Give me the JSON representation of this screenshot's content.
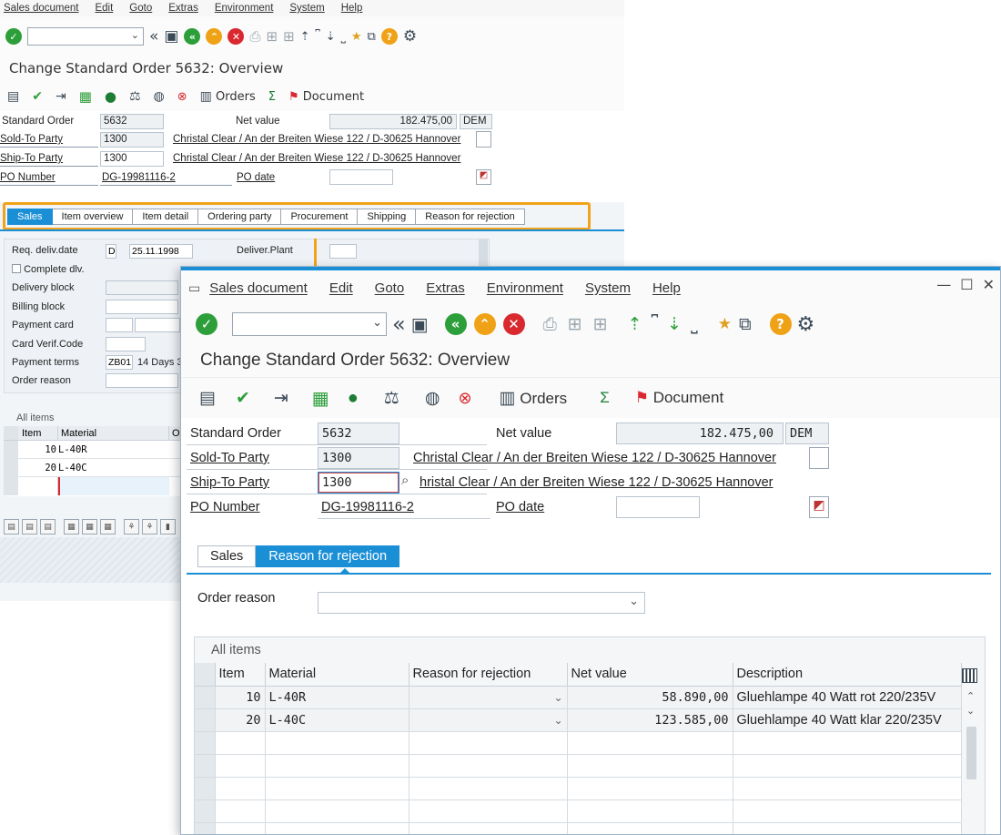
{
  "background_window": {
    "menu": [
      "Sales document",
      "Edit",
      "Goto",
      "Extras",
      "Environment",
      "System",
      "Help"
    ],
    "title": "Change Standard Order 5632: Overview",
    "app_toolbar": {
      "orders_label": "Orders",
      "sum_symbol": "Σ",
      "document_label": "Document"
    },
    "header": {
      "standard_order_label": "Standard Order",
      "standard_order_value": "5632",
      "net_value_label": "Net value",
      "net_value": "182.475,00",
      "currency": "DEM",
      "sold_to_label": "Sold-To Party",
      "sold_to_value": "1300",
      "sold_to_desc": "Christal Clear / An der Breiten Wiese 122 / D-30625 Hannover",
      "ship_to_label": "Ship-To Party",
      "ship_to_value": "1300",
      "ship_to_desc": "Christal Clear / An der Breiten Wiese 122 / D-30625 Hannover",
      "po_number_label": "PO Number",
      "po_number_value": "DG-19981116-2",
      "po_date_label": "PO date"
    },
    "tabs": [
      "Sales",
      "Item overview",
      "Item detail",
      "Ordering party",
      "Procurement",
      "Shipping",
      "Reason for rejection"
    ],
    "sales_panel": {
      "req_deliv_label": "Req. deliv.date",
      "req_deliv_format": "D",
      "req_deliv_value": "25.11.1998",
      "deliver_plant_label": "Deliver.Plant",
      "complete_dlv_label": "Complete dlv.",
      "delivery_block_label": "Delivery block",
      "billing_block_label": "Billing block",
      "payment_card_label": "Payment card",
      "card_verif_label": "Card Verif.Code",
      "payment_terms_label": "Payment terms",
      "payment_terms_value": "ZB01",
      "payment_terms_desc": "14 Days 3",
      "order_reason_label": "Order reason"
    },
    "items": {
      "title": "All items",
      "columns": [
        "Item",
        "Material",
        "O"
      ],
      "rows": [
        {
          "item": "10",
          "material": "L-40R"
        },
        {
          "item": "20",
          "material": "L-40C"
        }
      ]
    }
  },
  "foreground_window": {
    "menu": [
      "Sales document",
      "Edit",
      "Goto",
      "Extras",
      "Environment",
      "System",
      "Help"
    ],
    "title": "Change Standard Order 5632: Overview",
    "app_toolbar": {
      "orders_label": "Orders",
      "sum_symbol": "Σ",
      "document_label": "Document"
    },
    "header": {
      "standard_order_label": "Standard Order",
      "standard_order_value": "5632",
      "net_value_label": "Net value",
      "net_value": "182.475,00",
      "currency": "DEM",
      "sold_to_label": "Sold-To Party",
      "sold_to_value": "1300",
      "sold_to_desc": "Christal Clear / An der Breiten Wiese 122 / D-30625 Hannover",
      "ship_to_label": "Ship-To Party",
      "ship_to_value": "1300",
      "ship_to_desc": "hristal Clear / An der Breiten Wiese 122 / D-30625 Hannover",
      "po_number_label": "PO Number",
      "po_number_value": "DG-19981116-2",
      "po_date_label": "PO date",
      "po_date_value": ""
    },
    "tabs": [
      {
        "label": "Sales",
        "active": false
      },
      {
        "label": "Reason for rejection",
        "active": true
      }
    ],
    "order_reason_label": "Order reason",
    "order_reason_value": "",
    "items": {
      "title": "All items",
      "columns": [
        "Item",
        "Material",
        "Reason for rejection",
        "Net value",
        "Description"
      ],
      "rows": [
        {
          "item": "10",
          "material": "L-40R",
          "reason": "",
          "net_value": "58.890,00",
          "description": "Gluehlampe 40 Watt rot 220/235V"
        },
        {
          "item": "20",
          "material": "L-40C",
          "reason": "",
          "net_value": "123.585,00",
          "description": "Gluehlampe 40 Watt klar 220/235V"
        }
      ]
    }
  },
  "colors": {
    "sap_blue": "#1b8fd6",
    "highlight_orange": "#f2a31b",
    "ok_green": "#2d9f3a",
    "cancel_red": "#d9282e"
  }
}
